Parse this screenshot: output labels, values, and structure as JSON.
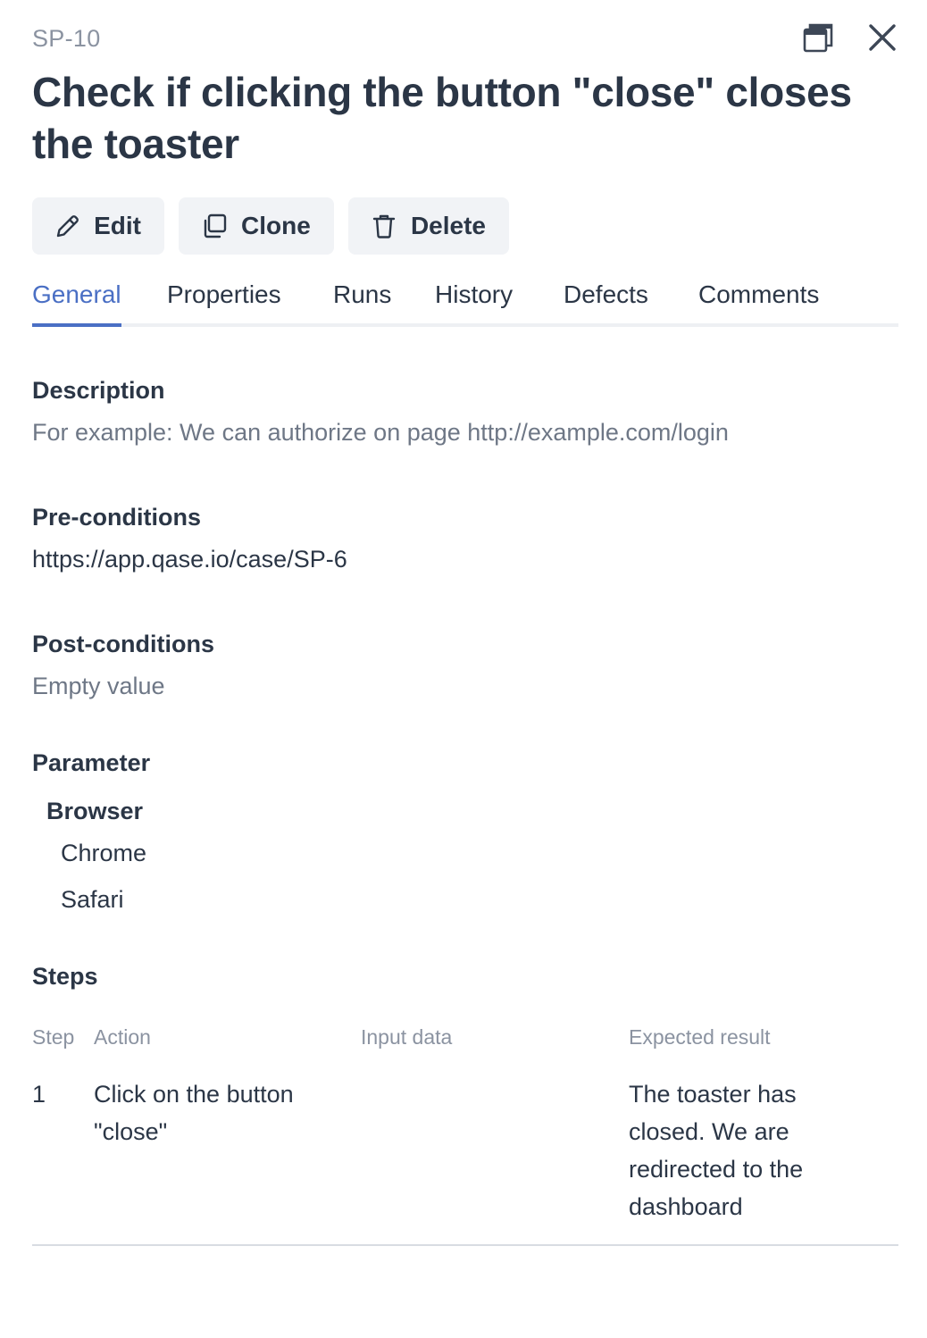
{
  "case": {
    "id": "SP-10",
    "title": "Check if clicking the button \"close\" closes the toaster"
  },
  "toolbar": {
    "edit_label": "Edit",
    "clone_label": "Clone",
    "delete_label": "Delete"
  },
  "tabs": [
    {
      "label": "General",
      "active": true
    },
    {
      "label": "Properties"
    },
    {
      "label": "Runs"
    },
    {
      "label": "History"
    },
    {
      "label": "Defects"
    },
    {
      "label": "Comments"
    }
  ],
  "description": {
    "label": "Description",
    "value": "For example: We can authorize on page http://example.com/login"
  },
  "preconditions": {
    "label": "Pre-conditions",
    "value": "https://app.qase.io/case/SP-6"
  },
  "postconditions": {
    "label": "Post-conditions",
    "value": "Empty value"
  },
  "parameter": {
    "label": "Parameter",
    "name": "Browser",
    "values": [
      "Chrome",
      "Safari"
    ]
  },
  "steps": {
    "label": "Steps",
    "columns": [
      "Step",
      "Action",
      "Input data",
      "Expected result"
    ],
    "rows": [
      {
        "step": "1",
        "action_line1": "Click on the button",
        "action_line2": "\"close\"",
        "input": "",
        "expected_line1": "The toaster has",
        "expected_line2": "closed. We are",
        "expected_line3": "redirected to the",
        "expected_line4": "dashboard"
      }
    ]
  },
  "colors": {
    "accent": "#4a6fc4",
    "text": "#2b3646",
    "muted": "#8b93a1",
    "button_bg": "#f1f3f6"
  },
  "icons": [
    "restore-window-icon",
    "close-icon",
    "pencil-icon",
    "copy-icon",
    "trash-icon"
  ]
}
